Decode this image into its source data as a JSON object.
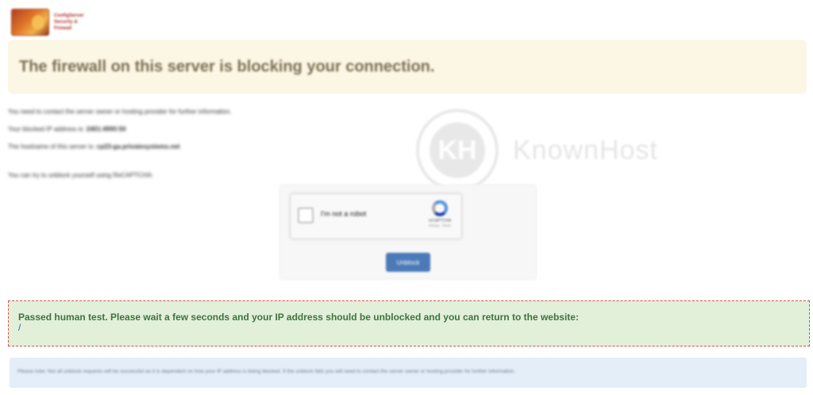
{
  "header": {
    "logo_lines": [
      "ConfigServer",
      "Security &",
      "Firewall"
    ]
  },
  "banner": {
    "title": "The firewall on this server is blocking your connection."
  },
  "info": {
    "contact_text": "You need to contact the server owner or hosting provider for further information.",
    "ip_label": "Your blocked IP address is:",
    "ip_value": "2401:4900:50",
    "host_label": "The hostname of this server is:",
    "host_value": "cp23-ga.privatesystems.net",
    "unblock_hint": "You can try to unblock yourself using ReCAPTCHA:"
  },
  "watermark": {
    "letters": "KH",
    "text": "KnownHost"
  },
  "recaptcha": {
    "label": "I'm not a robot",
    "brand": "reCAPTCHA",
    "terms": "Privacy - Terms",
    "checked": false
  },
  "unblock_button": {
    "label": "Unblock"
  },
  "success": {
    "message": "Passed human test. Please wait a few seconds and your IP address should be unblocked and you can return to the website:",
    "link": "/"
  },
  "note": {
    "text": "Please note: Not all unblock requests will be successful as it is dependent on how your IP address is being blocked. If the unblock fails you will need to contact the server owner or hosting provider for further information."
  },
  "colors": {
    "banner_bg": "#fcf6e5",
    "success_bg": "#e2efd9",
    "success_border": "#d9534f",
    "note_bg": "#e4eef8",
    "button_bg": "#4b7ab8"
  }
}
